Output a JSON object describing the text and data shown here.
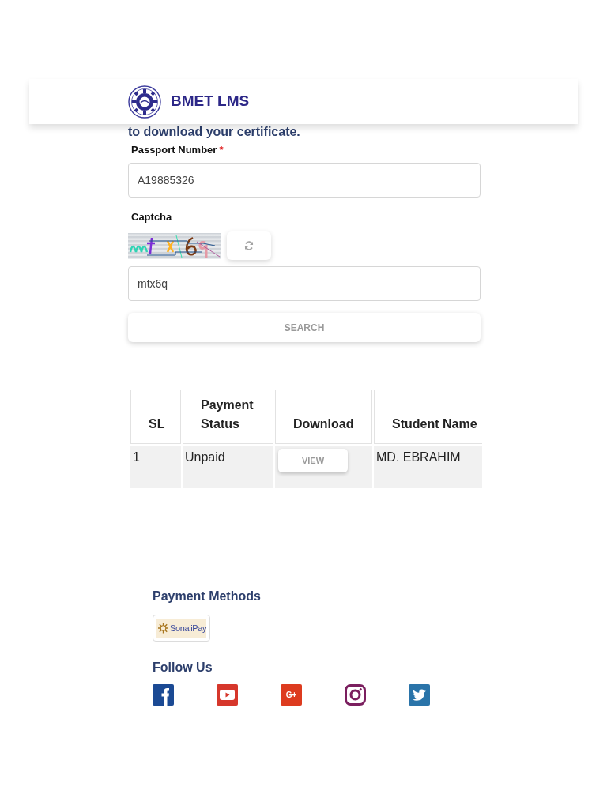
{
  "header": {
    "title": "BMET LMS"
  },
  "intro": {
    "text": "to download your certificate."
  },
  "form": {
    "fields": [
      {
        "kind": "text",
        "label": "Passport Number",
        "required_mark": "*",
        "value": "A19885326"
      },
      {
        "kind": "captcha",
        "label": "Captcha",
        "value": "mtx6q"
      }
    ],
    "search_button": "SEARCH"
  },
  "table": {
    "columns": [
      "SL",
      "Payment Status",
      "Download",
      "Student Name"
    ],
    "rows": [
      {
        "cells": [
          {
            "kind": "text",
            "text": "1"
          },
          {
            "kind": "text",
            "text": "Unpaid"
          },
          {
            "kind": "button",
            "text": "VIEW"
          },
          {
            "kind": "text",
            "text": "MD. EBRAHIM"
          }
        ]
      }
    ]
  },
  "payment_methods": {
    "title": "Payment Methods",
    "items": [
      {
        "kind": "sonalipay",
        "label": "SonaliPay"
      }
    ]
  },
  "follow_us": {
    "title": "Follow Us",
    "links": [
      {
        "kind": "facebook",
        "color": "#1b4a94"
      },
      {
        "kind": "youtube",
        "color": "#d6372b"
      },
      {
        "kind": "google_plus",
        "color": "#dd3b1f",
        "glyph": "G+"
      },
      {
        "kind": "instagram",
        "color": "#7b1f5f"
      },
      {
        "kind": "twitter",
        "color": "#2a74a9"
      }
    ]
  }
}
